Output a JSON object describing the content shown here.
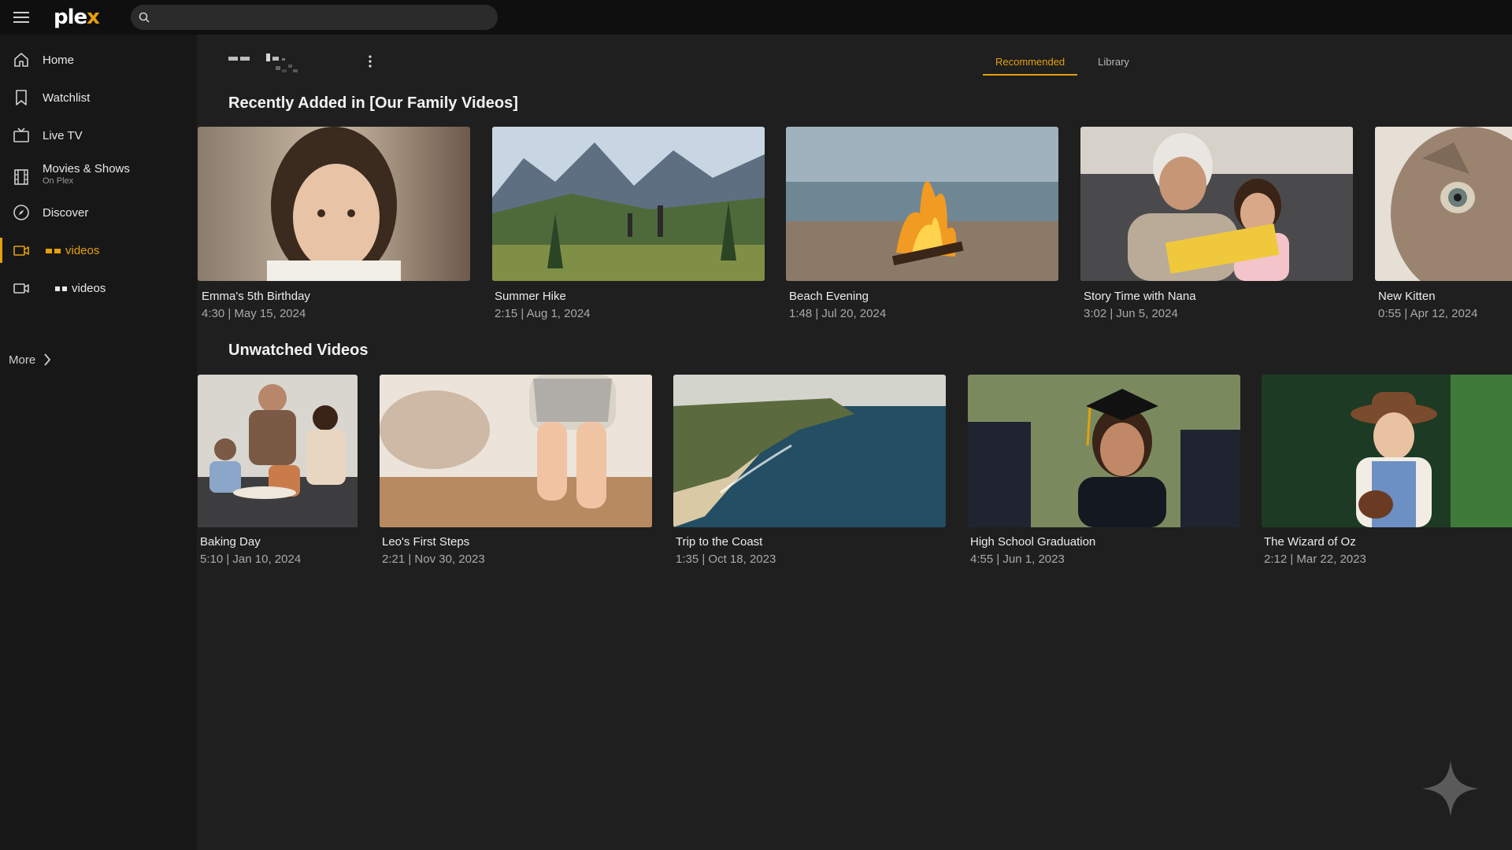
{
  "app": {
    "logo_main": "ple",
    "logo_accent": "x",
    "brand_color": "#e5a00d"
  },
  "search": {
    "placeholder": "",
    "value": ""
  },
  "sidebar": {
    "items": [
      {
        "label": "Home",
        "sub": "",
        "icon": "home-icon"
      },
      {
        "label": "Watchlist",
        "sub": "",
        "icon": "bookmark-icon"
      },
      {
        "label": "Live TV",
        "sub": "",
        "icon": "tv-icon"
      },
      {
        "label": "Movies & Shows",
        "sub": "On Plex",
        "icon": "film-icon"
      },
      {
        "label": "Discover",
        "sub": "",
        "icon": "compass-icon"
      },
      {
        "label": "videos",
        "sub": "",
        "icon": "video-camera-icon",
        "active": true
      },
      {
        "label": "videos",
        "sub": "",
        "icon": "video-camera-icon"
      }
    ],
    "more_label": "More"
  },
  "tabs": [
    {
      "label": "Recommended",
      "active": true
    },
    {
      "label": "Library",
      "active": false
    }
  ],
  "sections": [
    {
      "title": "Recently Added in [Our Family Videos]",
      "items": [
        {
          "title": "Emma's 5th Birthday",
          "meta": "4:30 | May 15, 2024"
        },
        {
          "title": "Summer Hike",
          "meta": "2:15 | Aug 1, 2024"
        },
        {
          "title": "Beach Evening",
          "meta": "1:48 | Jul 20, 2024"
        },
        {
          "title": "Story Time with Nana",
          "meta": "3:02 | Jun 5, 2024"
        },
        {
          "title": "New Kitten",
          "meta": "0:55 | Apr 12, 2024"
        }
      ]
    },
    {
      "title": "Unwatched Videos",
      "items": [
        {
          "title": "Baking Day",
          "meta": "5:10 | Jan 10, 2024"
        },
        {
          "title": "Leo's First Steps",
          "meta": "2:21 | Nov 30, 2023"
        },
        {
          "title": "Trip to the Coast",
          "meta": "1:35 | Oct 18, 2023"
        },
        {
          "title": "High School Graduation",
          "meta": "4:55 | Jun 1, 2023"
        },
        {
          "title": "The Wizard of Oz",
          "meta": "2:12 | Mar 22, 2023"
        }
      ]
    }
  ]
}
